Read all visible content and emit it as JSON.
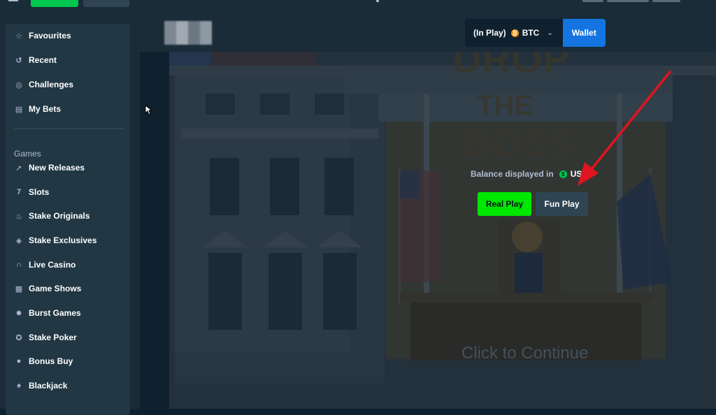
{
  "sidebar": {
    "items": [
      {
        "label": "Favourites",
        "icon": "star-icon"
      },
      {
        "label": "Recent",
        "icon": "history-icon"
      },
      {
        "label": "Challenges",
        "icon": "target-icon"
      },
      {
        "label": "My Bets",
        "icon": "receipt-icon"
      }
    ],
    "games_section": "Games",
    "games": [
      {
        "label": "New Releases",
        "icon": "rocket-icon"
      },
      {
        "label": "Slots",
        "icon": "slots-icon"
      },
      {
        "label": "Stake Originals",
        "icon": "flame-icon"
      },
      {
        "label": "Stake Exclusives",
        "icon": "gem-icon"
      },
      {
        "label": "Live Casino",
        "icon": "headset-icon"
      },
      {
        "label": "Game Shows",
        "icon": "gift-icon"
      },
      {
        "label": "Burst Games",
        "icon": "burst-icon"
      },
      {
        "label": "Stake Poker",
        "icon": "poker-chip-icon"
      },
      {
        "label": "Bonus Buy",
        "icon": "coin-icon"
      },
      {
        "label": "Blackjack",
        "icon": "cards-icon"
      }
    ]
  },
  "header": {
    "currency_label": "(In Play)",
    "currency": "BTC",
    "wallet_label": "Wallet"
  },
  "game": {
    "balance_prefix": "Balance displayed in",
    "balance_currency": "USD",
    "real_play": "Real Play",
    "fun_play": "Fun Play",
    "continue_text": "Click to Continue"
  },
  "colors": {
    "accent_green": "#00e701",
    "wallet_blue": "#1475e1",
    "annotation_red": "#e0141e"
  }
}
